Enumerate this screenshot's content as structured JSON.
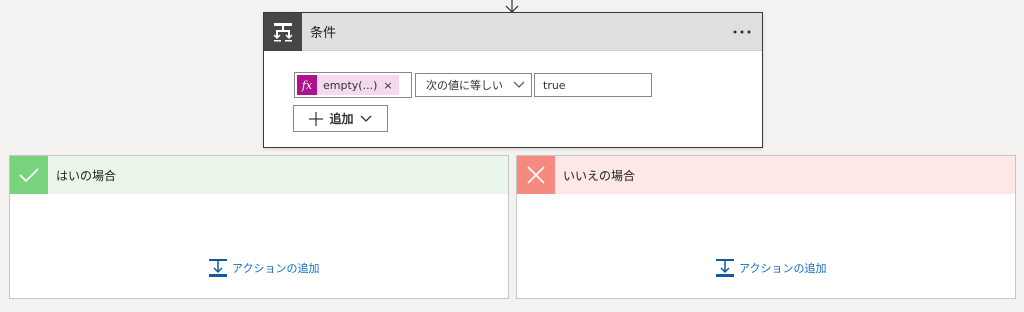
{
  "condition": {
    "title": "条件",
    "more_icon": "more-horizontal-icon",
    "expression": {
      "token_label": "empty(...)",
      "token_close": "×",
      "token_color": "#ae128e",
      "operator": "次の値に等しい",
      "value": "true"
    },
    "add_button_label": "追加"
  },
  "branches": {
    "yes": {
      "title": "はいの場合",
      "add_action_label": "アクションの追加",
      "accent_color": "#79d37d"
    },
    "no": {
      "title": "いいえの場合",
      "add_action_label": "アクションの追加",
      "accent_color": "#f78a80"
    }
  }
}
